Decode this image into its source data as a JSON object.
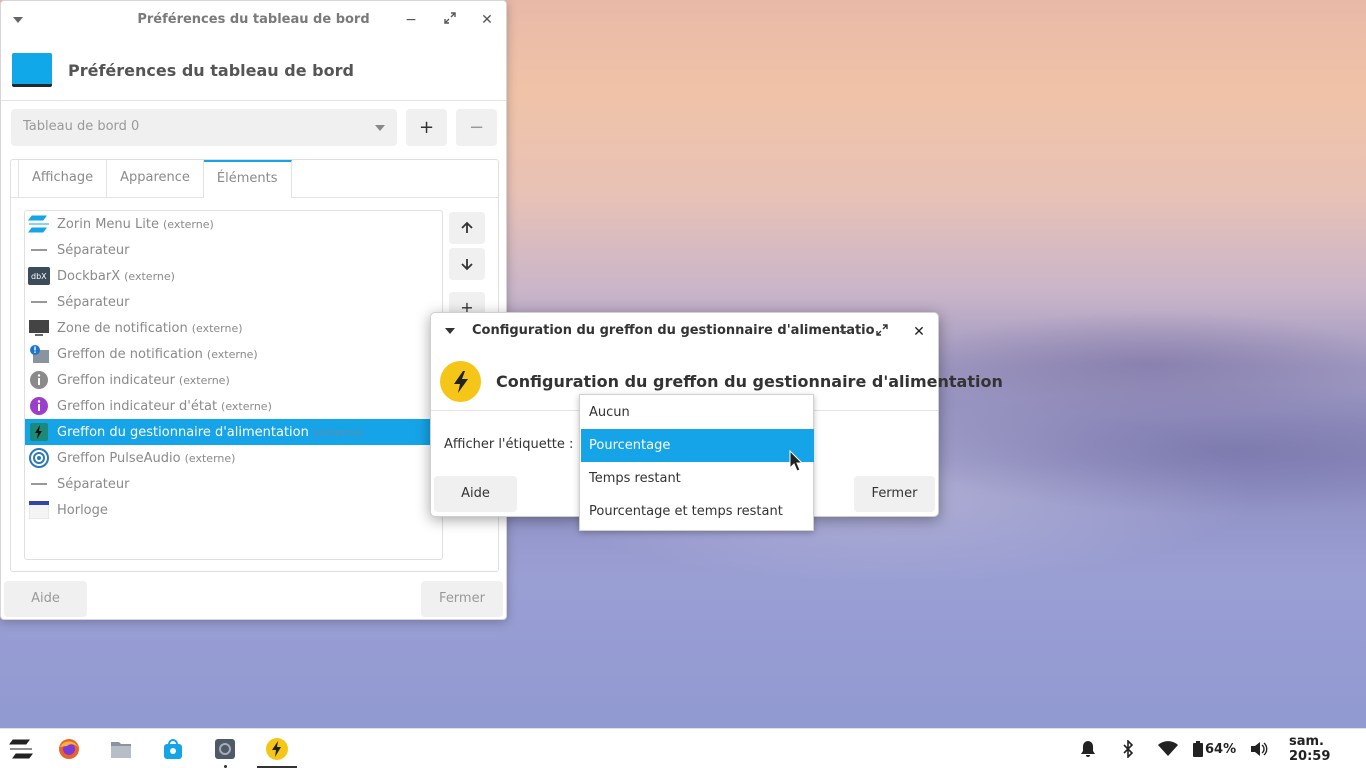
{
  "main_window": {
    "title": "Préférences du tableau de bord",
    "heading": "Préférences du tableau de bord",
    "panel_selector": "Tableau de bord 0",
    "add_label": "+",
    "remove_label": "−",
    "tabs": [
      {
        "label": "Affichage",
        "active": false
      },
      {
        "label": "Apparence",
        "active": false
      },
      {
        "label": "Éléments",
        "active": true
      }
    ],
    "items": [
      {
        "name": "Zorin Menu Lite",
        "suffix": "(externe)",
        "icon": "zorin-logo-icon",
        "selected": false
      },
      {
        "name": "Séparateur",
        "suffix": "",
        "icon": "separator-icon",
        "selected": false
      },
      {
        "name": "DockbarX",
        "suffix": "(externe)",
        "icon": "dockbarx-icon",
        "selected": false
      },
      {
        "name": "Séparateur",
        "suffix": "",
        "icon": "separator-icon",
        "selected": false
      },
      {
        "name": "Zone de notification",
        "suffix": "(externe)",
        "icon": "monitor-icon",
        "selected": false
      },
      {
        "name": "Greffon de notification",
        "suffix": "(externe)",
        "icon": "notification-icon",
        "selected": false
      },
      {
        "name": "Greffon indicateur",
        "suffix": "(externe)",
        "icon": "info-gray-icon",
        "selected": false
      },
      {
        "name": "Greffon indicateur d'état",
        "suffix": "(externe)",
        "icon": "info-purple-icon",
        "selected": false
      },
      {
        "name": "Greffon du gestionnaire d'alimentation",
        "suffix": "(externe)",
        "icon": "power-bolt-icon",
        "selected": true
      },
      {
        "name": "Greffon PulseAudio",
        "suffix": "(externe)",
        "icon": "pulseaudio-icon",
        "selected": false
      },
      {
        "name": "Séparateur",
        "suffix": "",
        "icon": "separator-icon",
        "selected": false
      },
      {
        "name": "Horloge",
        "suffix": "",
        "icon": "clock-icon",
        "selected": false
      }
    ],
    "help_label": "Aide",
    "close_label": "Fermer"
  },
  "dialog": {
    "title": "Configuration du greffon du gestionnaire d'alimentatio",
    "heading": "Configuration du greffon du gestionnaire d'alimentation",
    "label": "Afficher l'étiquette :",
    "options": [
      "Aucun",
      "Pourcentage",
      "Temps restant",
      "Pourcentage et temps restant"
    ],
    "selected_option": "Pourcentage",
    "help_label": "Aide",
    "close_label": "Fermer"
  },
  "taskbar": {
    "battery": "64%",
    "clock": "sam. 20:59"
  },
  "colors": {
    "accent": "#15a4e8",
    "bolt_yellow": "#f5c518"
  }
}
